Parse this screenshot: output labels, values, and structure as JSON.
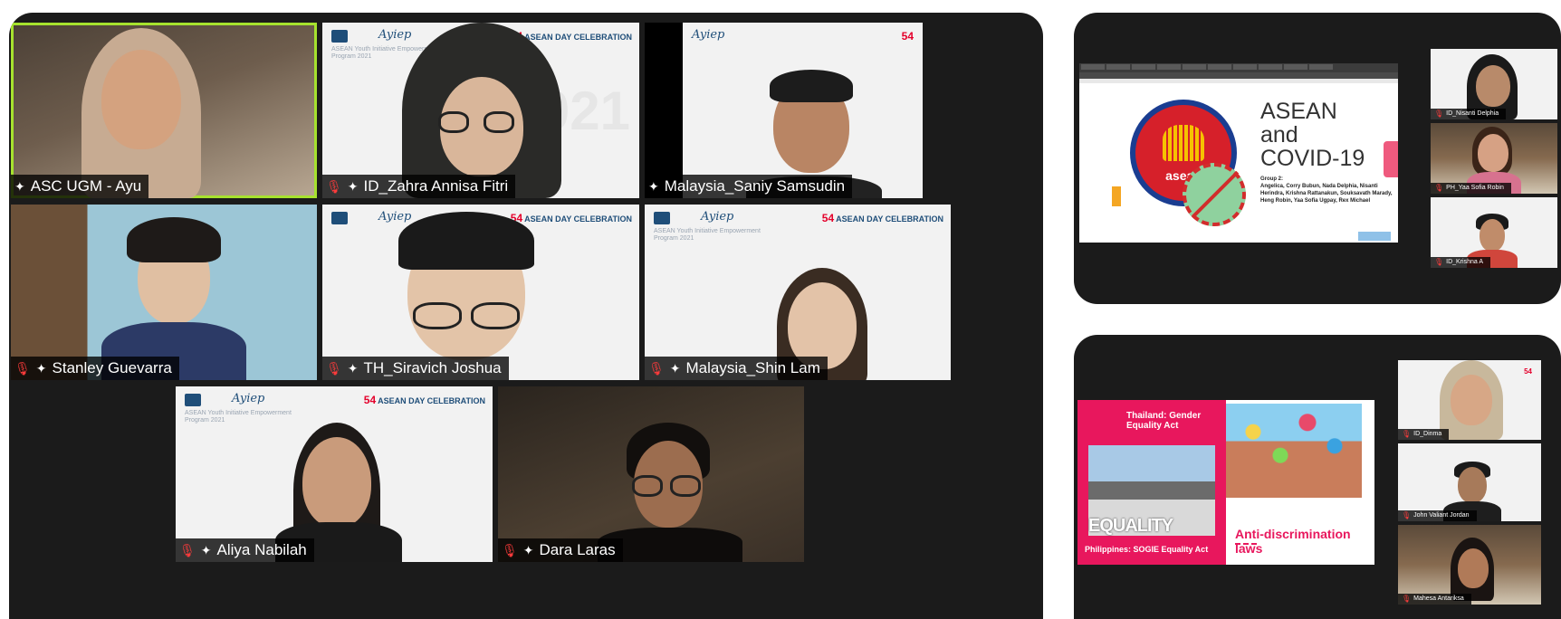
{
  "main_gallery": {
    "participants": [
      {
        "name": "ASC UGM - Ayu",
        "muted": false,
        "pinned": true,
        "active_speaker": true
      },
      {
        "name": "ID_Zahra Annisa Fitri",
        "muted": true,
        "pinned": true
      },
      {
        "name": "Malaysia_Saniy Samsudin",
        "muted": false,
        "pinned": true
      },
      {
        "name": "Stanley Guevarra",
        "muted": true,
        "pinned": true
      },
      {
        "name": "TH_Siravich Joshua",
        "muted": true,
        "pinned": true
      },
      {
        "name": "Malaysia_Shin Lam",
        "muted": true,
        "pinned": true
      },
      {
        "name": "Aliya Nabilah",
        "muted": true,
        "pinned": true
      },
      {
        "name": "Dara Laras",
        "muted": true,
        "pinned": true
      }
    ],
    "virtual_background": {
      "brand": "Ayiep",
      "program": "ASEAN Youth Initiative Empowerment Program 2021",
      "badge_number": "54",
      "badge_text": "ASEAN DAY CELEBRATION",
      "year": "2021"
    }
  },
  "top_right_screen": {
    "slide_title_lines": [
      "ASEAN",
      "and",
      "COVID-19"
    ],
    "logo_word": "asean",
    "group_heading": "Group 2:",
    "group_members": "Angelica, Corry Bubun, Nada Delphia, Nisanti Herindra, Krishna Rattanakun, Souksavath Marady, Heng Robin, Yaa Sofia Ugpay, Rex Michael",
    "thumbnails": [
      {
        "name": "ID_Nisanti Delphia"
      },
      {
        "name": "PH_Yaa Sofia Robin"
      },
      {
        "name": "ID_Krishna A"
      }
    ]
  },
  "bottom_right_screen": {
    "thailand_caption": "Thailand: Gender Equality Act",
    "sign_text": "EQUALITY",
    "philippines_caption": "Philippines: SOGIE Equality Act",
    "anti_discrimination": "Anti-discrimination laws",
    "thumbnails": [
      {
        "name": "ID_Dinma"
      },
      {
        "name": "John Valiant Jordan"
      },
      {
        "name": "Mahesa Antariksa"
      }
    ]
  },
  "icons": {
    "mic_muted": "mic-muted-icon",
    "pin": "pin-icon"
  },
  "colors": {
    "panel_bg": "#1b1b1b",
    "active_speaker_outline": "#a6e22e",
    "muted_red": "#ff3b3b",
    "slide_pink": "#e8175d"
  }
}
